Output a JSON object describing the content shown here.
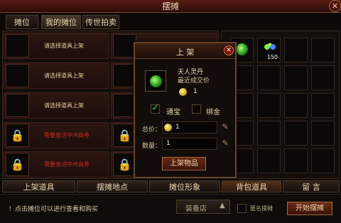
{
  "title": "摆摊",
  "tabs_top": [
    "摊位",
    "我的摊位",
    "传世拍卖"
  ],
  "stall_rows": [
    {
      "text": "请选择道具上架",
      "locked": false
    },
    {
      "text": "请选择道具上架",
      "locked": false
    },
    {
      "text": "请选择道具上架",
      "locked": false
    },
    {
      "text": "需要激活中州商券",
      "locked": true
    },
    {
      "text": "需要激活中州商券",
      "locked": true
    }
  ],
  "dialog": {
    "title": "上 架",
    "item_name": "天人灵丹",
    "recent_price_label": "最近成交价",
    "recent_price_value": "1",
    "currency_options": [
      "通宝",
      "绑金"
    ],
    "currency_checked": [
      true,
      false
    ],
    "total_label": "总价：",
    "total_value": "1",
    "quantity_label": "数量：",
    "quantity_value": "1",
    "submit_label": "上架物品"
  },
  "bag_items": [
    {
      "icon": "green-orb-icon",
      "count": ""
    },
    {
      "icon": "mixed-orbs-icon",
      "count": "150"
    }
  ],
  "bottom_tabs": [
    "上架道具",
    "摆摊地点",
    "摊位形象",
    "背包道具",
    "留 言"
  ],
  "active_bottom_tab": "背包道具",
  "footer": {
    "hint": "！点击摊位可以进行查看和购买",
    "shop_select": "装备店",
    "anonymous_label": "匿名摆摊",
    "start_button": "开始摆摊"
  },
  "colors": {
    "accent_red": "#d02818",
    "gold": "#d9a826",
    "green_check": "#3cc83c"
  }
}
